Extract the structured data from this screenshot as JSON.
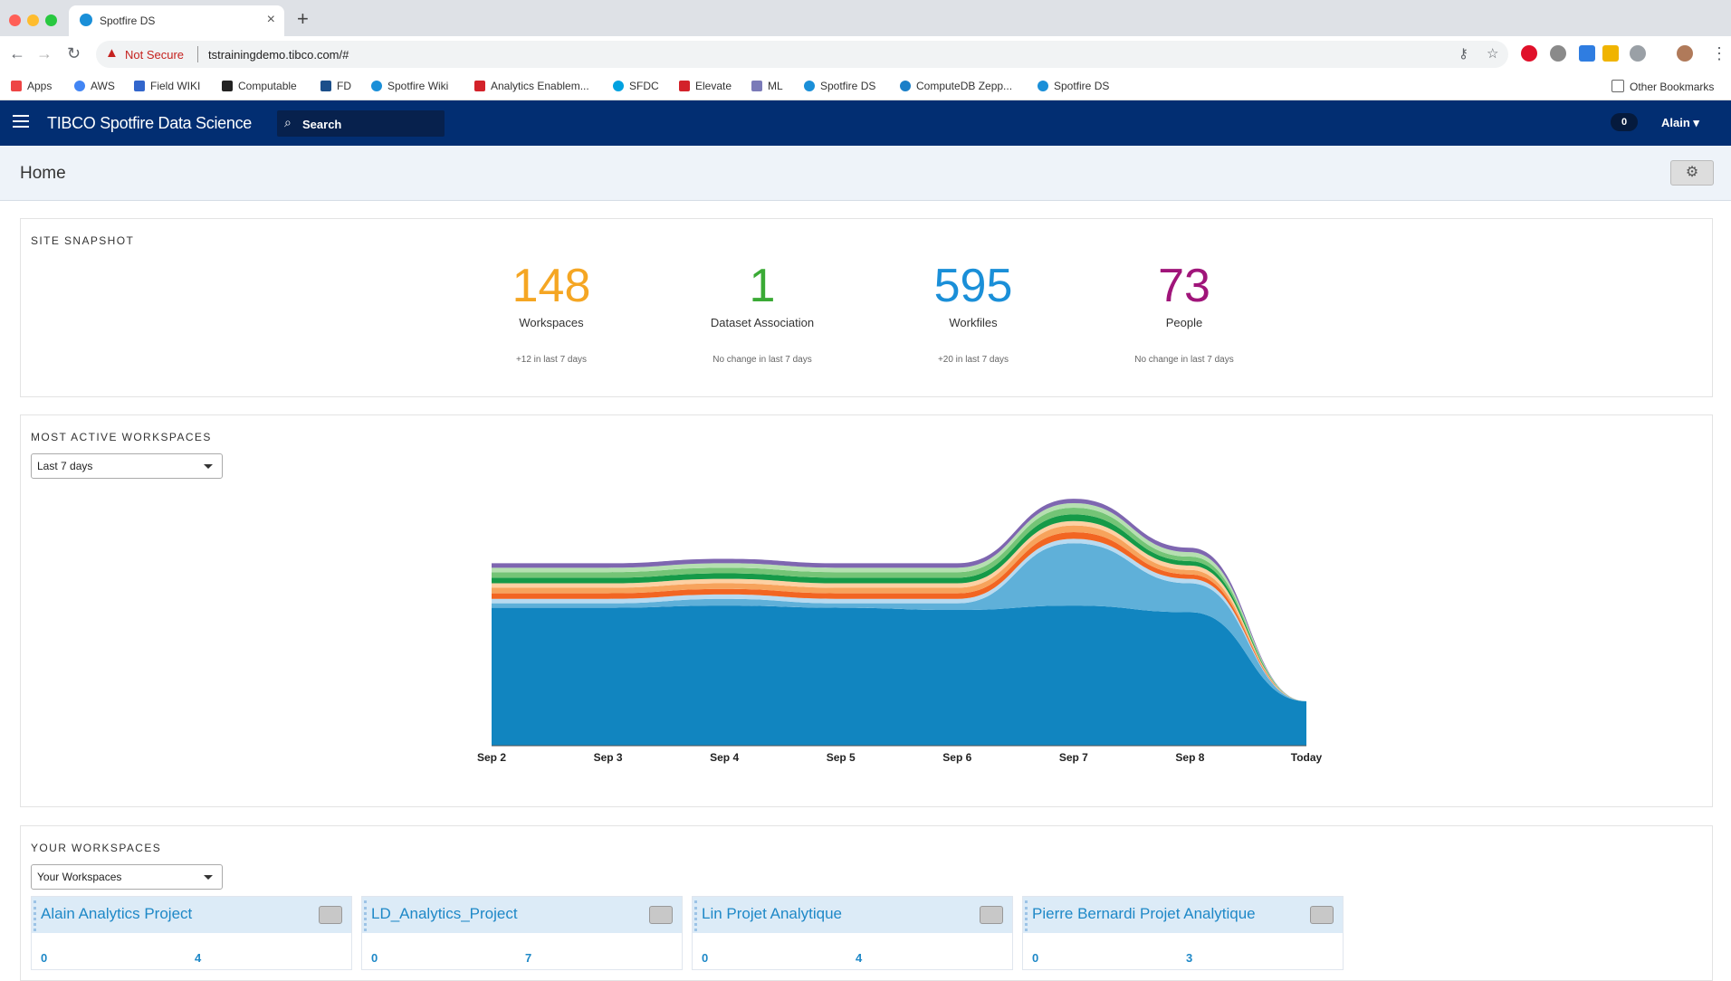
{
  "browser": {
    "tab_title": "Spotfire DS",
    "not_secure": "Not Secure",
    "url": "tstrainingdemo.tibco.com/#",
    "bookmarks": [
      "Apps",
      "AWS",
      "Field WIKI",
      "Computable",
      "FD",
      "Spotfire Wiki",
      "Analytics Enablem...",
      "SFDC",
      "Elevate",
      "ML",
      "Spotfire DS",
      "ComputeDB Zepp...",
      "Spotfire DS"
    ],
    "other_bookmarks": "Other Bookmarks"
  },
  "app": {
    "logo": "TIBCO Spotfire Data Science",
    "search_label": "Search",
    "notifications": "0",
    "user": "Alain"
  },
  "page": {
    "title": "Home"
  },
  "snapshot": {
    "title": "SITE SNAPSHOT",
    "stats": [
      {
        "value": "148",
        "label": "Workspaces",
        "change": "+12 in last 7 days",
        "color": "#f5a623"
      },
      {
        "value": "1",
        "label": "Dataset Association",
        "change": "No change in last 7 days",
        "color": "#3aaa35"
      },
      {
        "value": "595",
        "label": "Workfiles",
        "change": "+20 in last 7 days",
        "color": "#1a8fd8"
      },
      {
        "value": "73",
        "label": "People",
        "change": "No change in last 7 days",
        "color": "#a0157a"
      }
    ]
  },
  "active": {
    "title": "MOST ACTIVE WORKSPACES",
    "range": "Last 7 days"
  },
  "chart_data": {
    "type": "area",
    "stacked": true,
    "x": [
      "Sep 2",
      "Sep 3",
      "Sep 4",
      "Sep 5",
      "Sep 6",
      "Sep 7",
      "Sep 8",
      "Today"
    ],
    "series": [
      {
        "color": "#1185c0",
        "values": [
          0.62,
          0.62,
          0.63,
          0.62,
          0.61,
          0.63,
          0.6,
          0.2
        ]
      },
      {
        "color": "#5fb0d9",
        "values": [
          0.02,
          0.02,
          0.03,
          0.02,
          0.03,
          0.28,
          0.13,
          0
        ]
      },
      {
        "color": "#b8daf0",
        "values": [
          0.02,
          0.02,
          0.02,
          0.02,
          0.02,
          0.02,
          0.02,
          0
        ]
      },
      {
        "color": "#f26522",
        "values": [
          0.025,
          0.025,
          0.025,
          0.025,
          0.025,
          0.03,
          0.02,
          0
        ]
      },
      {
        "color": "#f7a35c",
        "values": [
          0.025,
          0.025,
          0.025,
          0.025,
          0.025,
          0.03,
          0.02,
          0
        ]
      },
      {
        "color": "#fdd0a2",
        "values": [
          0.02,
          0.02,
          0.02,
          0.02,
          0.02,
          0.02,
          0.02,
          0
        ]
      },
      {
        "color": "#159a48",
        "values": [
          0.025,
          0.025,
          0.025,
          0.025,
          0.025,
          0.03,
          0.02,
          0
        ]
      },
      {
        "color": "#74c476",
        "values": [
          0.025,
          0.025,
          0.025,
          0.025,
          0.025,
          0.03,
          0.02,
          0
        ]
      },
      {
        "color": "#b5dfb0",
        "values": [
          0.02,
          0.02,
          0.02,
          0.02,
          0.02,
          0.02,
          0.02,
          0
        ]
      },
      {
        "color": "#7e66b0",
        "values": [
          0.02,
          0.02,
          0.02,
          0.02,
          0.02,
          0.02,
          0.02,
          0
        ]
      }
    ],
    "ylim": [
      0,
      1.2
    ],
    "grid": false,
    "legend": "none"
  },
  "yours": {
    "title": "YOUR WORKSPACES",
    "filter": "Your Workspaces",
    "cards": [
      {
        "name": "Alain Analytics Project",
        "a": "0",
        "b": "4"
      },
      {
        "name": "LD_Analytics_Project",
        "a": "0",
        "b": "7"
      },
      {
        "name": "Lin Projet Analytique",
        "a": "0",
        "b": "4"
      },
      {
        "name": "Pierre Bernardi Projet Analytique",
        "a": "0",
        "b": "3"
      }
    ]
  }
}
